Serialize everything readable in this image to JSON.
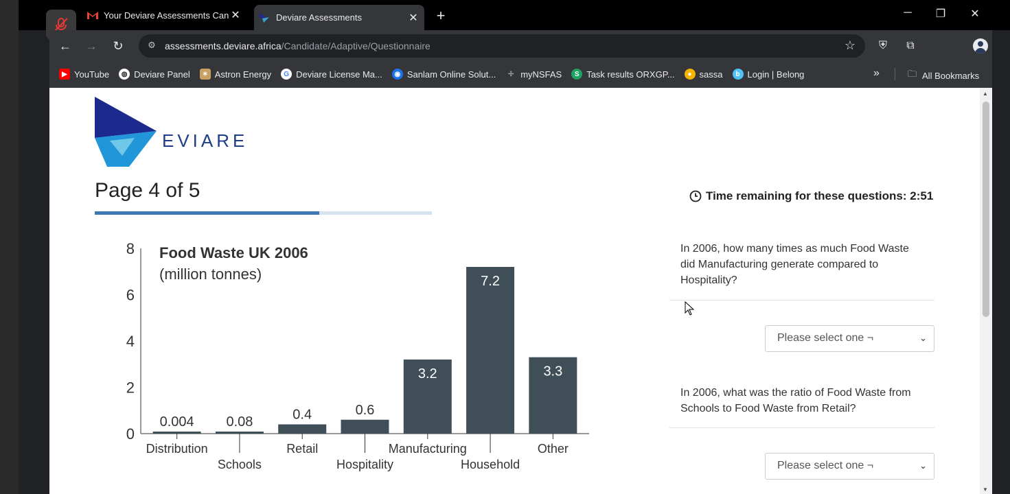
{
  "browser": {
    "tabs": [
      {
        "title": "Your Deviare Assessments Canc",
        "active": false
      },
      {
        "title": "Deviare Assessments",
        "active": true
      }
    ],
    "url_host": "assessments.deviare.africa",
    "url_path": "/Candidate/Adaptive/Questionnaire",
    "bookmarks": [
      {
        "label": "YouTube",
        "color": "#ff0000"
      },
      {
        "label": "Deviare Panel",
        "color": "#ffffff"
      },
      {
        "label": "Astron Energy",
        "color": "#c8a060"
      },
      {
        "label": "Deviare License Ma...",
        "color": "#4285f4"
      },
      {
        "label": "Sanlam Online Solut...",
        "color": "#1a73e8"
      },
      {
        "label": "myNSFAS",
        "color": "#5f6368"
      },
      {
        "label": "Task results ORXGP...",
        "color": "#1ea362"
      },
      {
        "label": "sassa",
        "color": "#f4b400"
      },
      {
        "label": "Login | Belong",
        "color": "#4fc3f7"
      }
    ],
    "all_bookmarks": "All Bookmarks"
  },
  "page": {
    "logo_text": "EVIARE",
    "title": "Page 4 of 5",
    "progress_fraction": 0.667,
    "timer_text": "Time remaining for these questions: 2:51",
    "questions": [
      {
        "text": "In 2006, how many times as much Food Waste did Manufacturing generate compared to Hospitality?",
        "select": "Please select one ¬"
      },
      {
        "text": "In 2006, what was the ratio of Food Waste from Schools to Food Waste from Retail?",
        "select": "Please select one ¬"
      }
    ]
  },
  "chart_data": {
    "type": "bar",
    "title": "Food Waste UK 2006",
    "subtitle": "(million tonnes)",
    "categories": [
      "Distribution",
      "Schools",
      "Retail",
      "Hospitality",
      "Manufacturing",
      "Household",
      "Other"
    ],
    "values": [
      0.004,
      0.08,
      0.4,
      0.6,
      3.2,
      7.2,
      3.3
    ],
    "value_labels": [
      "0.004",
      "0.08",
      "0.4",
      "0.6",
      "3.2",
      "7.2",
      "3.3"
    ],
    "y_ticks": [
      "0",
      "2",
      "4",
      "6",
      "8"
    ],
    "ylim": [
      0,
      8
    ],
    "bar_color": "#404f57",
    "grid": false
  }
}
